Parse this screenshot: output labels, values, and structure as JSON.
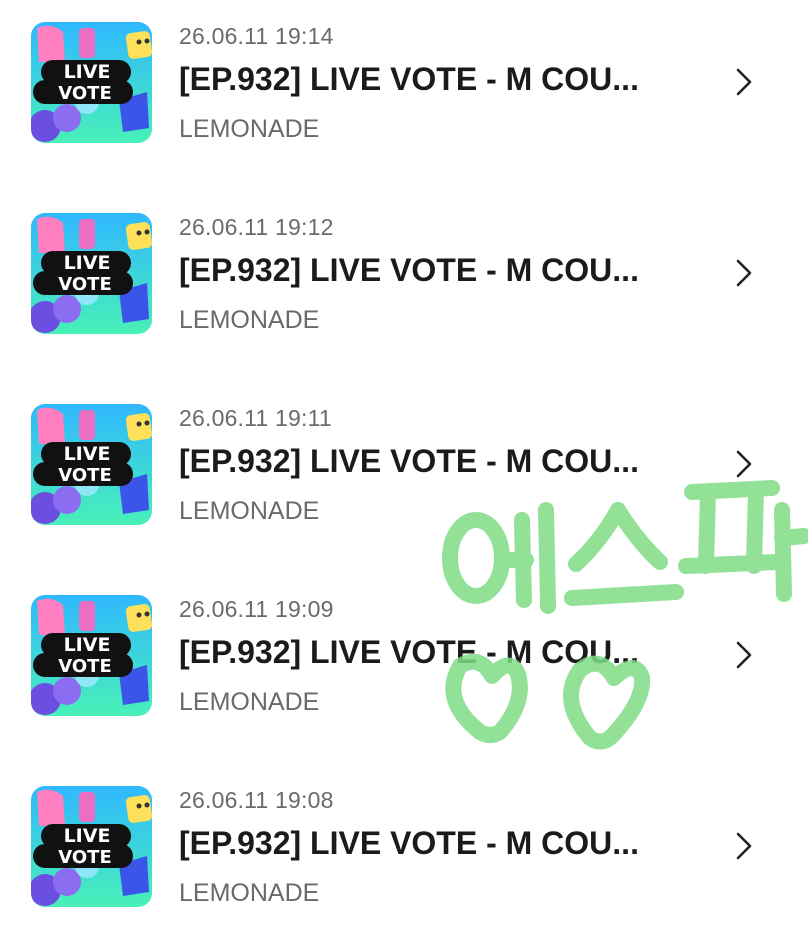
{
  "items": [
    {
      "date": "26.06.11 19:14",
      "title": "[EP.932] LIVE VOTE - M COU...",
      "artist": "LEMONADE",
      "thumb_icon": "live-vote-thumbnail",
      "thumb_line1": "LIVE",
      "thumb_line2": "VOTE"
    },
    {
      "date": "26.06.11 19:12",
      "title": "[EP.932] LIVE VOTE - M COU...",
      "artist": "LEMONADE",
      "thumb_icon": "live-vote-thumbnail",
      "thumb_line1": "LIVE",
      "thumb_line2": "VOTE"
    },
    {
      "date": "26.06.11 19:11",
      "title": "[EP.932] LIVE VOTE - M COU...",
      "artist": "LEMONADE",
      "thumb_icon": "live-vote-thumbnail",
      "thumb_line1": "LIVE",
      "thumb_line2": "VOTE"
    },
    {
      "date": "26.06.11 19:09",
      "title": "[EP.932] LIVE VOTE - M COU...",
      "artist": "LEMONADE",
      "thumb_icon": "live-vote-thumbnail",
      "thumb_line1": "LIVE",
      "thumb_line2": "VOTE"
    },
    {
      "date": "26.06.11 19:08",
      "title": "[EP.932] LIVE VOTE - M COU...",
      "artist": "LEMONADE",
      "thumb_icon": "live-vote-thumbnail",
      "thumb_line1": "LIVE",
      "thumb_line2": "VOTE"
    }
  ],
  "overlay": {
    "handwriting_text": "에스파",
    "handwriting_color": "#7fdc86",
    "shapes": "two hearts"
  },
  "colors": {
    "title": "#1b1b1b",
    "secondary": "#6a6a6a",
    "thumb_gradient_top": "#2fb8ff",
    "thumb_gradient_bottom": "#49f0b8",
    "thumb_badge": "#111111"
  }
}
